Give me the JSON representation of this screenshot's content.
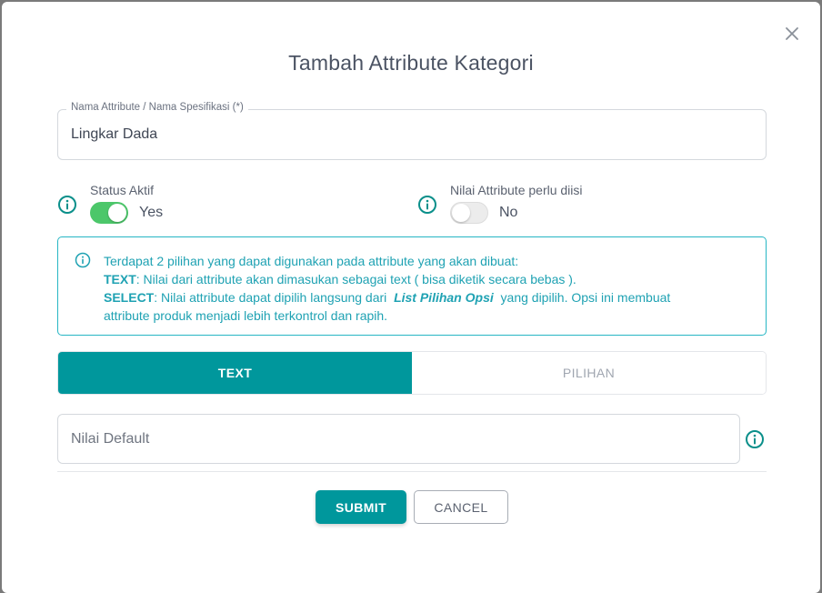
{
  "modal": {
    "title": "Tambah Attribute Kategori"
  },
  "attribute_name": {
    "label": "Nama Attribute / Nama Spesifikasi (*)",
    "value": "Lingkar Dada"
  },
  "status_aktif": {
    "label": "Status Aktif",
    "state": "Yes",
    "on": true
  },
  "nilai_perlu_diisi": {
    "label": "Nilai Attribute perlu diisi",
    "state": "No",
    "on": false
  },
  "notice": {
    "intro": "Terdapat 2 pilihan yang dapat digunakan pada attribute yang akan dibuat:",
    "text_key": "TEXT",
    "text_desc": ": Nilai dari attribute akan dimasukan sebagai text ( bisa diketik secara bebas ).",
    "select_key": "SELECT",
    "select_desc_pre": ": Nilai attribute dapat dipilih langsung dari ",
    "select_link": "List Pilihan Opsi",
    "select_desc_post": " yang dipilih. Opsi ini membuat",
    "select_desc_line2": "attribute produk menjadi lebih terkontrol dan rapih."
  },
  "tabs": [
    {
      "label": "TEXT",
      "active": true
    },
    {
      "label": "PILIHAN",
      "active": false
    }
  ],
  "default_value": {
    "placeholder": "Nilai Default",
    "value": ""
  },
  "actions": {
    "submit": "SUBMIT",
    "cancel": "CANCEL"
  },
  "colors": {
    "primary": "#00979c",
    "toggle_on": "#4cc76a",
    "notice": "#1fa2b3",
    "info_icon": "#0a8f8a"
  }
}
